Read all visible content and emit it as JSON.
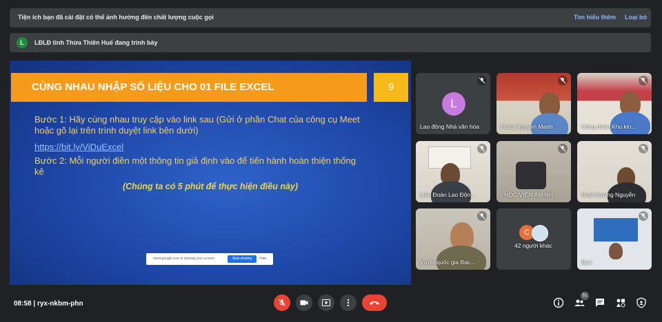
{
  "notice": {
    "message": "Tiện ích bạn đã cài đặt có thể ảnh hưởng đến chất lượng cuộc gọi",
    "learn_more": "Tìm hiểu thêm",
    "dismiss": "Loại bỏ"
  },
  "presenter": {
    "avatar_letter": "L",
    "text": "LĐLĐ tỉnh Thừa Thiên Huế đang trình bày"
  },
  "slide": {
    "title": "CÙNG NHAU NHẬP SỐ LIỆU CHO 01 FILE EXCEL",
    "number": "9",
    "step1": "Bước 1: Hãy cùng nhau truy cập vào link sau (Gửi ở phần Chat của công cụ Meet hoặc gõ lại trên trình duyệt link bên dưới)",
    "link": "https://bit.ly/ViDuExcel",
    "step2": "Bước 2: Mỗi người điền một thông tin giả định vào để tiến hành hoàn thiện thống kê",
    "note": "(Chúng ta có 5 phút để thực hiện điều này)",
    "share_text": "meet.google.com is sharing your screen.",
    "stop_sharing": "Stop sharing",
    "hide": "Hide"
  },
  "participants": [
    {
      "name": "Lao động Nhà văn hóa",
      "avatar": "L"
    },
    {
      "name": "Hung Nguyen Manh"
    },
    {
      "name": "Công đoàn Khu kin..."
    },
    {
      "name": "Liên Đoàn Lao Độn..."
    },
    {
      "name": "- HỌC VIỆN ÂM NH..."
    },
    {
      "name": "Hoài Hương Nguyễn"
    },
    {
      "name": "Vườn quốc gia Bạc..."
    },
    {
      "name": "42 người khác",
      "avatar": "C"
    },
    {
      "name": "Bạn"
    }
  ],
  "bottom": {
    "time": "08:58",
    "separator": "|",
    "meeting_code": "ryx-nkbm-phn",
    "people_count": "51"
  },
  "colors": {
    "accent_red": "#ea4335",
    "link_blue": "#8ab4f8",
    "slide_orange": "#f59a1b"
  }
}
